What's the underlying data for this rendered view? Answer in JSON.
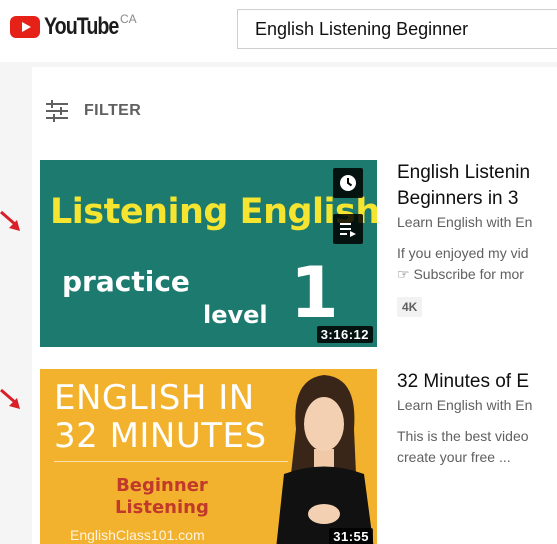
{
  "header": {
    "logo_text": "YouTube",
    "region": "CA",
    "search_value": "English Listening Beginner"
  },
  "filter": {
    "label": "FILTER",
    "icon": "filter-sliders-icon"
  },
  "colors": {
    "brand_red": "#e62117",
    "annotation_arrow": "#d9202a"
  },
  "results": [
    {
      "title_lines": [
        "English Listenin",
        "Beginners in 3 "
      ],
      "channel": "Learn English with En",
      "description_lines": [
        "If you enjoyed my vid",
        "☞ Subscribe for mor"
      ],
      "badge": "4K",
      "duration": "3:16:12",
      "thumbnail": {
        "headline": "Listening English",
        "practice": "practice",
        "level_label": "level",
        "level_number": "1"
      },
      "hover_icons": [
        "clock-icon",
        "playlist-add-icon"
      ]
    },
    {
      "title_lines": [
        "32 Minutes of E"
      ],
      "channel": "Learn English with En",
      "description_lines": [
        "This is the best video",
        "create your free ..."
      ],
      "duration": "31:55",
      "thumbnail": {
        "headline": "ENGLISH IN 32 MINUTES",
        "sub_line_1": "Beginner",
        "sub_line_2": "Listening",
        "url": "EnglishClass101.com"
      }
    }
  ]
}
